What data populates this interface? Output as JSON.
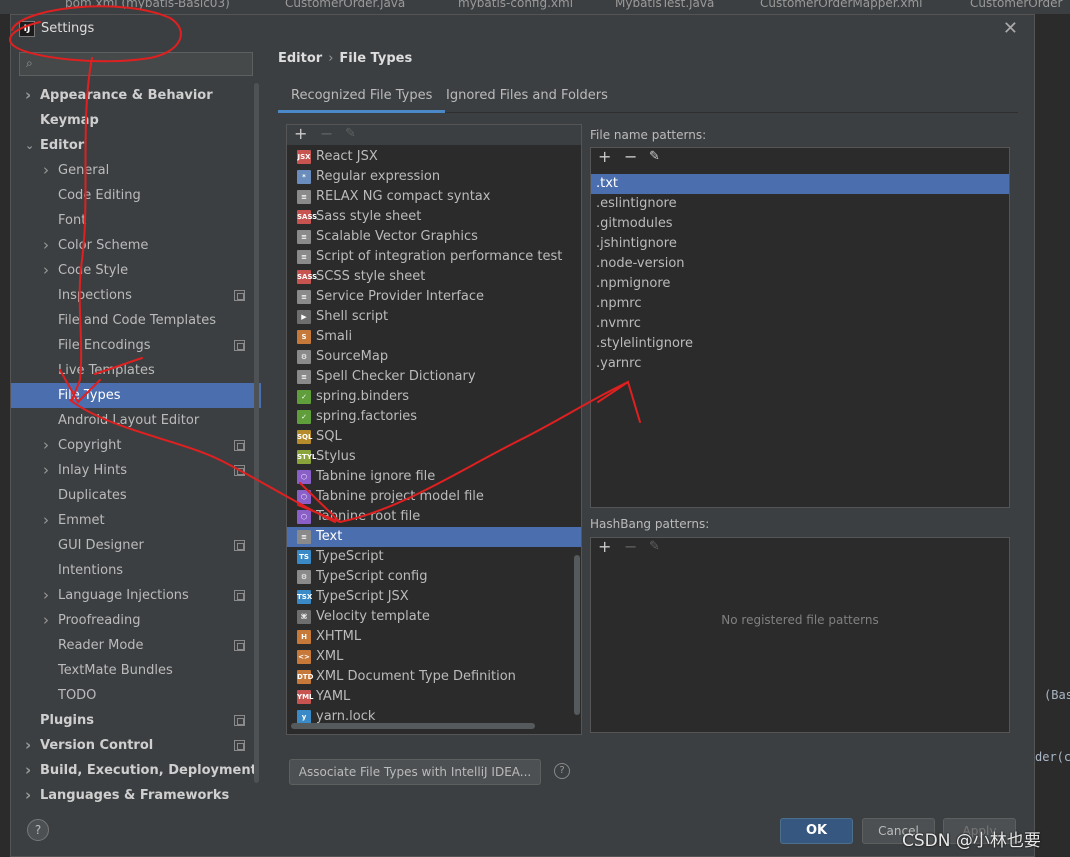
{
  "ide_tabs": [
    "pom.xml (mybatis-Basic03)",
    "CustomerOrder.java",
    "mybatis-config.xml",
    "MybatisTest.java",
    "CustomerOrderMapper.xml",
    "CustomerOrder"
  ],
  "background_code": [
    "(Bas",
    "der(c"
  ],
  "dialog": {
    "title": "Settings",
    "logo": "IJ"
  },
  "search": {
    "placeholder": ""
  },
  "sidebar": {
    "items": [
      {
        "label": "Appearance & Behavior",
        "level": 0,
        "bold": true,
        "arrow": "right",
        "proj": false
      },
      {
        "label": "Keymap",
        "level": 0,
        "bold": true,
        "arrow": "",
        "proj": false
      },
      {
        "label": "Editor",
        "level": 0,
        "bold": true,
        "arrow": "down",
        "proj": false
      },
      {
        "label": "General",
        "level": 1,
        "bold": false,
        "arrow": "right",
        "proj": false
      },
      {
        "label": "Code Editing",
        "level": 1,
        "bold": false,
        "arrow": "",
        "proj": false
      },
      {
        "label": "Font",
        "level": 1,
        "bold": false,
        "arrow": "",
        "proj": false
      },
      {
        "label": "Color Scheme",
        "level": 1,
        "bold": false,
        "arrow": "right",
        "proj": false
      },
      {
        "label": "Code Style",
        "level": 1,
        "bold": false,
        "arrow": "right",
        "proj": false
      },
      {
        "label": "Inspections",
        "level": 1,
        "bold": false,
        "arrow": "",
        "proj": true
      },
      {
        "label": "File and Code Templates",
        "level": 1,
        "bold": false,
        "arrow": "",
        "proj": false
      },
      {
        "label": "File Encodings",
        "level": 1,
        "bold": false,
        "arrow": "",
        "proj": true
      },
      {
        "label": "Live Templates",
        "level": 1,
        "bold": false,
        "arrow": "",
        "proj": false
      },
      {
        "label": "File Types",
        "level": 1,
        "bold": false,
        "arrow": "",
        "proj": false,
        "selected": true
      },
      {
        "label": "Android Layout Editor",
        "level": 1,
        "bold": false,
        "arrow": "",
        "proj": false
      },
      {
        "label": "Copyright",
        "level": 1,
        "bold": false,
        "arrow": "right",
        "proj": true
      },
      {
        "label": "Inlay Hints",
        "level": 1,
        "bold": false,
        "arrow": "right",
        "proj": true
      },
      {
        "label": "Duplicates",
        "level": 1,
        "bold": false,
        "arrow": "",
        "proj": false
      },
      {
        "label": "Emmet",
        "level": 1,
        "bold": false,
        "arrow": "right",
        "proj": false
      },
      {
        "label": "GUI Designer",
        "level": 1,
        "bold": false,
        "arrow": "",
        "proj": true
      },
      {
        "label": "Intentions",
        "level": 1,
        "bold": false,
        "arrow": "",
        "proj": false
      },
      {
        "label": "Language Injections",
        "level": 1,
        "bold": false,
        "arrow": "right",
        "proj": true
      },
      {
        "label": "Proofreading",
        "level": 1,
        "bold": false,
        "arrow": "right",
        "proj": false
      },
      {
        "label": "Reader Mode",
        "level": 1,
        "bold": false,
        "arrow": "",
        "proj": true
      },
      {
        "label": "TextMate Bundles",
        "level": 1,
        "bold": false,
        "arrow": "",
        "proj": false
      },
      {
        "label": "TODO",
        "level": 1,
        "bold": false,
        "arrow": "",
        "proj": false
      },
      {
        "label": "Plugins",
        "level": 0,
        "bold": true,
        "arrow": "",
        "proj": true
      },
      {
        "label": "Version Control",
        "level": 0,
        "bold": true,
        "arrow": "right",
        "proj": true
      },
      {
        "label": "Build, Execution, Deployment",
        "level": 0,
        "bold": true,
        "arrow": "right",
        "proj": false
      },
      {
        "label": "Languages & Frameworks",
        "level": 0,
        "bold": true,
        "arrow": "right",
        "proj": false
      }
    ]
  },
  "breadcrumb": {
    "parent": "Editor",
    "separator": "›",
    "current": "File Types"
  },
  "tabs": [
    {
      "label": "Recognized File Types",
      "active": true
    },
    {
      "label": "Ignored Files and Folders",
      "active": false
    }
  ],
  "toolbar_icons": {
    "add": "+",
    "remove": "−",
    "edit": "✎"
  },
  "file_types": [
    {
      "label": "React JSX",
      "icon": "JSX",
      "color": "#c75450"
    },
    {
      "label": "Regular expression",
      "icon": "*",
      "color": "#6a8dbd"
    },
    {
      "label": "RELAX NG compact syntax",
      "icon": "≡",
      "color": "#8a8a8a"
    },
    {
      "label": "Sass style sheet",
      "icon": "SASS",
      "color": "#c75450"
    },
    {
      "label": "Scalable Vector Graphics",
      "icon": "≡",
      "color": "#8a8a8a"
    },
    {
      "label": "Script of integration performance test",
      "icon": "≡",
      "color": "#8a8a8a"
    },
    {
      "label": "SCSS style sheet",
      "icon": "SASS",
      "color": "#c75450"
    },
    {
      "label": "Service Provider Interface",
      "icon": "≡",
      "color": "#8a8a8a"
    },
    {
      "label": "Shell script",
      "icon": "▶",
      "color": "#6e6e6e"
    },
    {
      "label": "Smali",
      "icon": "S",
      "color": "#c7793a"
    },
    {
      "label": "SourceMap",
      "icon": "⚙",
      "color": "#8a8a8a"
    },
    {
      "label": "Spell Checker Dictionary",
      "icon": "≡",
      "color": "#8a8a8a"
    },
    {
      "label": "spring.binders",
      "icon": "✓",
      "color": "#5f9e3a"
    },
    {
      "label": "spring.factories",
      "icon": "✓",
      "color": "#5f9e3a"
    },
    {
      "label": "SQL",
      "icon": "SQL",
      "color": "#b58b2b"
    },
    {
      "label": "Stylus",
      "icon": "STYL",
      "color": "#8aa33a"
    },
    {
      "label": "Tabnine ignore file",
      "icon": "⬡",
      "color": "#8a5fc7"
    },
    {
      "label": "Tabnine project model file",
      "icon": "⬡",
      "color": "#8a5fc7"
    },
    {
      "label": "Tabnine root file",
      "icon": "⬡",
      "color": "#8a5fc7"
    },
    {
      "label": "Text",
      "icon": "≡",
      "color": "#8a8a8a",
      "selected": true
    },
    {
      "label": "TypeScript",
      "icon": "TS",
      "color": "#3a8ac7"
    },
    {
      "label": "TypeScript config",
      "icon": "⚙",
      "color": "#8a8a8a"
    },
    {
      "label": "TypeScript JSX",
      "icon": "TSX",
      "color": "#3a8ac7"
    },
    {
      "label": "Velocity template",
      "icon": "⌘",
      "color": "#6e6e6e"
    },
    {
      "label": "XHTML",
      "icon": "H",
      "color": "#c7793a"
    },
    {
      "label": "XML",
      "icon": "<>",
      "color": "#c7793a"
    },
    {
      "label": "XML Document Type Definition",
      "icon": "DTD",
      "color": "#c7793a"
    },
    {
      "label": "YAML",
      "icon": "YML",
      "color": "#c75450"
    },
    {
      "label": "yarn.lock",
      "icon": "y",
      "color": "#3a8ac7"
    }
  ],
  "file_name_patterns": {
    "label": "File name patterns:",
    "items": [
      ".txt",
      ".eslintignore",
      ".gitmodules",
      ".jshintignore",
      ".node-version",
      ".npmignore",
      ".npmrc",
      ".nvmrc",
      ".stylelintignore",
      ".yarnrc"
    ],
    "selected_index": 0
  },
  "hashbang_patterns": {
    "label": "HashBang patterns:",
    "empty_text": "No registered file patterns"
  },
  "associate_button": "Associate File Types with IntelliJ IDEA...",
  "help_glyph": "?",
  "footer": {
    "help": "?",
    "ok": "OK",
    "cancel": "Cancel",
    "apply": "Apply"
  },
  "watermark": "CSDN @小林也要",
  "colors": {
    "accent": "#4b6eaf",
    "annotation": "#e02020"
  }
}
